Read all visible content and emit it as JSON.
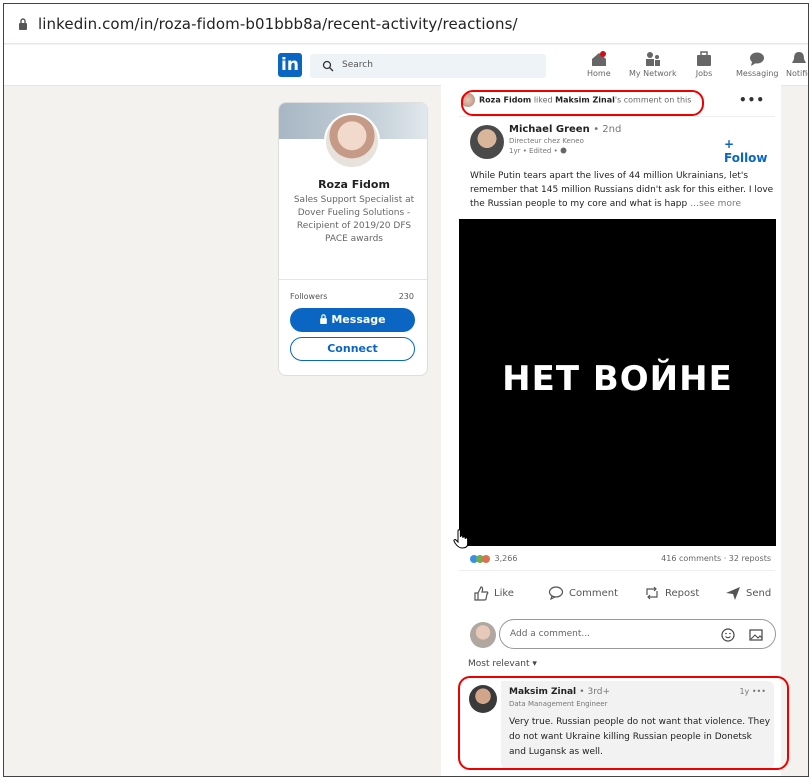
{
  "browser": {
    "url_host": "linkedin.com",
    "url_path": "/in/roza-fidom-b01bbb8a/recent-activity/reactions/"
  },
  "nav": {
    "logo": "in",
    "search_placeholder": "Search",
    "items": [
      {
        "label": "Home",
        "icon": "home-icon"
      },
      {
        "label": "My Network",
        "icon": "network-icon"
      },
      {
        "label": "Jobs",
        "icon": "jobs-icon"
      },
      {
        "label": "Messaging",
        "icon": "messaging-icon"
      },
      {
        "label": "Notific",
        "icon": "bell-icon"
      }
    ]
  },
  "profile": {
    "name": "Roza Fidom",
    "headline": "Sales Support Specialist at Dover Fueling Solutions - Recipient of 2019/20 DFS PACE awards",
    "followers_label": "Followers",
    "followers_count": "230",
    "message_label": "Message",
    "connect_label": "Connect"
  },
  "post": {
    "actor_name": "Roza Fidom",
    "actor_action": "liked",
    "actor_target": "Maksim Zinal",
    "actor_suffix": "'s comment on this",
    "author_name": "Michael Green",
    "author_degree": "• 2nd",
    "author_title": "Directeur chez Keneo",
    "author_meta": "1yr • Edited •",
    "follow_label": "+ Follow",
    "text": "While Putin tears apart the lives of 44 million Ukrainians, let's remember that 145 million Russians didn't ask for this either. I love the Russian people to my core and what is happ",
    "see_more": "…see more",
    "image_text": "НЕТ ВОЙНЕ",
    "reactions_count": "3,266",
    "comments_reposts": "416 comments · 32 reposts",
    "actions": {
      "like": "Like",
      "comment": "Comment",
      "repost": "Repost",
      "send": "Send"
    },
    "comment_placeholder": "Add a comment...",
    "sort_label": "Most relevant ▾"
  },
  "comment": {
    "name": "Maksim Zinal",
    "degree": "• 3rd+",
    "title": "Data Management Engineer",
    "time": "1y •••",
    "text": "Very true. Russian people do not want that violence. They do not want Ukraine killing Russian people in Donetsk and Lugansk as well."
  },
  "colors": {
    "brand": "#0a66c2",
    "annotation": "#ee0000",
    "page_bg": "#f4f2ee"
  }
}
